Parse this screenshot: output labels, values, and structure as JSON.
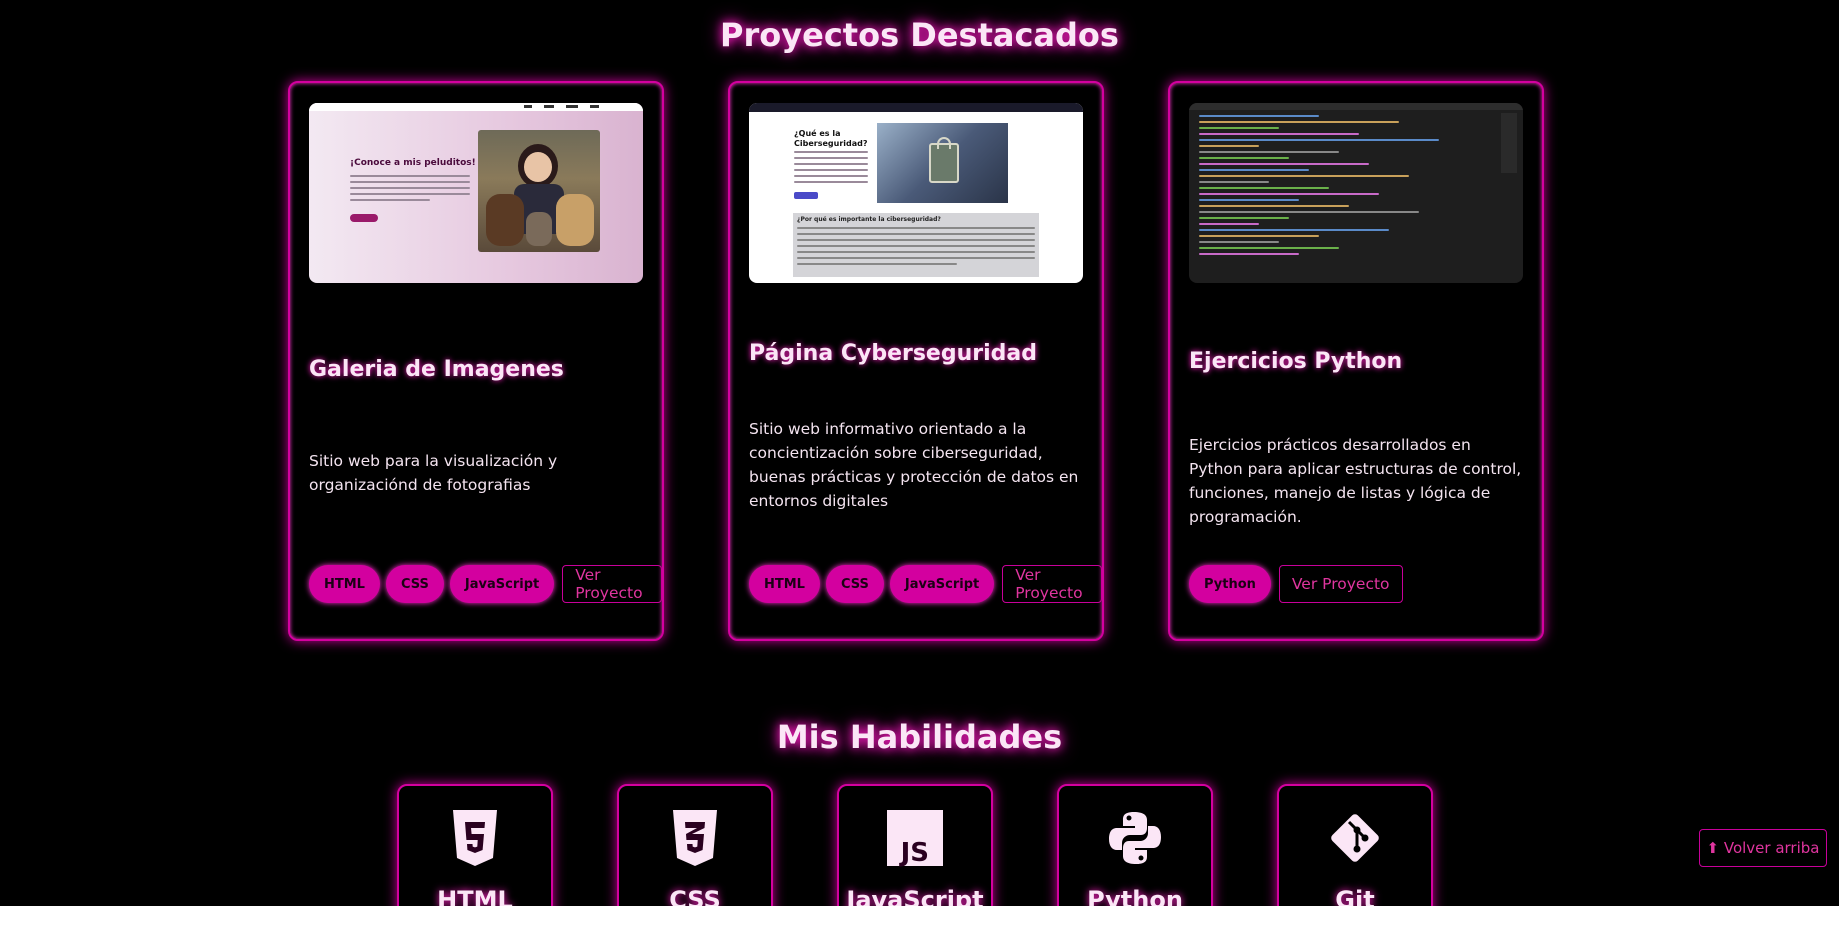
{
  "projects_section": {
    "title": "Proyectos Destacados"
  },
  "projects": [
    {
      "title": "Galeria de Imagenes",
      "description": "Sitio web para la visualización y organizaciónd de fotografias",
      "tags": [
        "HTML",
        "CSS",
        "JavaScript"
      ],
      "button": "Ver Proyecto",
      "thumb_heading": "¡Conoce a mis peluditos!"
    },
    {
      "title": "Página Cyberseguridad",
      "description": "Sitio web informativo orientado a la concientización sobre ciberseguridad, buenas prácticas y protección de datos en entornos digitales",
      "tags": [
        "HTML",
        "CSS",
        "JavaScript"
      ],
      "button": "Ver Proyecto",
      "thumb_heading": "¿Qué es la Ciberseguridad?",
      "thumb_subheading": "¿Por qué es importante la ciberseguridad?"
    },
    {
      "title": "Ejercicios Python",
      "description": "Ejercicios prácticos desarrollados en Python para aplicar estructuras de control, funciones, manejo de listas y lógica de programación.",
      "tags": [
        "Python"
      ],
      "button": "Ver Proyecto"
    }
  ],
  "skills_section": {
    "title": "Mis Habilidades"
  },
  "skills": [
    {
      "label": "HTML",
      "icon": "html5-icon"
    },
    {
      "label": "CSS",
      "icon": "css3-icon"
    },
    {
      "label": "JavaScript",
      "icon": "javascript-icon"
    },
    {
      "label": "Python",
      "icon": "python-icon"
    },
    {
      "label": "Git",
      "icon": "git-icon"
    }
  ],
  "back_to_top": "⬆ Volver arriba",
  "colors": {
    "accent": "#d3009f",
    "glow": "#ff1fc4",
    "background": "#000000"
  }
}
